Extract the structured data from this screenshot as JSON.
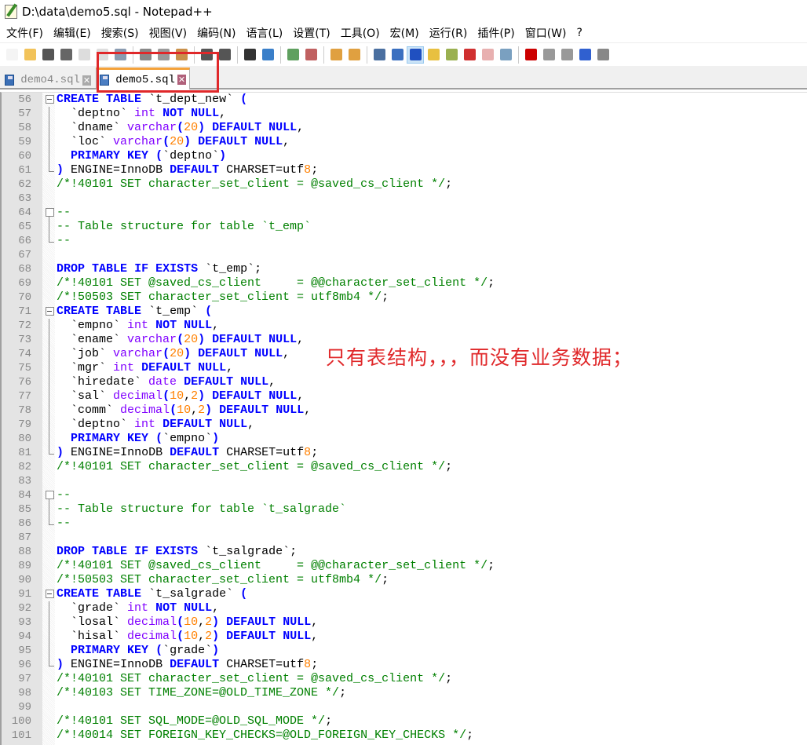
{
  "window": {
    "title": "D:\\data\\demo5.sql - Notepad++"
  },
  "menu": [
    "文件(F)",
    "编辑(E)",
    "搜索(S)",
    "视图(V)",
    "编码(N)",
    "语言(L)",
    "设置(T)",
    "工具(O)",
    "宏(M)",
    "运行(R)",
    "插件(P)",
    "窗口(W)",
    "?"
  ],
  "toolbar": [
    {
      "icon": "new-file-icon",
      "color": "#f4f4f4"
    },
    {
      "icon": "open-file-icon",
      "color": "#f2c35a"
    },
    {
      "icon": "save-icon",
      "color": "#555555"
    },
    {
      "icon": "save-all-icon",
      "color": "#666666"
    },
    {
      "icon": "close-icon",
      "color": "#dddddd"
    },
    {
      "icon": "close-all-icon",
      "color": "#dddddd"
    },
    {
      "icon": "print-icon",
      "color": "#8a9bb0"
    },
    "sep",
    {
      "icon": "cut-icon",
      "color": "#888888"
    },
    {
      "icon": "copy-icon",
      "color": "#999999"
    },
    {
      "icon": "paste-icon",
      "color": "#c9904a"
    },
    "sep",
    {
      "icon": "undo-icon",
      "color": "#555555"
    },
    {
      "icon": "redo-icon",
      "color": "#555555"
    },
    "sep",
    {
      "icon": "find-icon",
      "color": "#333333"
    },
    {
      "icon": "replace-icon",
      "color": "#3a7fc9"
    },
    "sep",
    {
      "icon": "zoom-in-icon",
      "color": "#5fa05f"
    },
    {
      "icon": "zoom-out-icon",
      "color": "#c06060"
    },
    "sep",
    {
      "icon": "sync-vertical-icon",
      "color": "#e0a040"
    },
    {
      "icon": "sync-horizontal-icon",
      "color": "#e0a040"
    },
    "sep",
    {
      "icon": "word-wrap-icon",
      "color": "#4a6fa0"
    },
    {
      "icon": "show-all-chars-icon",
      "color": "#3a6fc0"
    },
    {
      "icon": "indent-guide-icon",
      "color": "#2050c0",
      "active": true
    },
    {
      "icon": "udl-icon",
      "color": "#e8c040"
    },
    {
      "icon": "doc-map-icon",
      "color": "#9ab050"
    },
    {
      "icon": "function-list-icon",
      "color": "#d03030"
    },
    {
      "icon": "folder-workspace-icon",
      "color": "#e8b0b0"
    },
    {
      "icon": "monitoring-icon",
      "color": "#7aa0c0"
    },
    "sep",
    {
      "icon": "record-macro-icon",
      "color": "#cc0000"
    },
    {
      "icon": "stop-record-icon",
      "color": "#999999"
    },
    {
      "icon": "play-macro-icon",
      "color": "#999999"
    },
    {
      "icon": "run-macro-multiple-icon",
      "color": "#3060d0"
    },
    {
      "icon": "save-macro-icon",
      "color": "#888888"
    }
  ],
  "tabs": [
    {
      "label": "demo4.sql",
      "close": "✕"
    },
    {
      "label": "demo5.sql",
      "close": "✕"
    }
  ],
  "lines": [
    {
      "n": "56",
      "fold": "start",
      "text": "CREATE TABLE `t_dept_new` ("
    },
    {
      "n": "57",
      "fold": "mid",
      "text": "  `deptno` int NOT NULL,"
    },
    {
      "n": "58",
      "fold": "mid",
      "text": "  `dname` varchar(20) DEFAULT NULL,"
    },
    {
      "n": "59",
      "fold": "mid",
      "text": "  `loc` varchar(20) DEFAULT NULL,"
    },
    {
      "n": "60",
      "fold": "mid",
      "text": "  PRIMARY KEY (`deptno`)"
    },
    {
      "n": "61",
      "fold": "end",
      "text": ") ENGINE=InnoDB DEFAULT CHARSET=utf8;"
    },
    {
      "n": "62",
      "fold": "",
      "text": "/*!40101 SET character_set_client = @saved_cs_client */;"
    },
    {
      "n": "63",
      "fold": "",
      "text": ""
    },
    {
      "n": "64",
      "fold": "startc",
      "text": "--"
    },
    {
      "n": "65",
      "fold": "mid",
      "text": "-- Table structure for table `t_emp`"
    },
    {
      "n": "66",
      "fold": "end",
      "text": "--"
    },
    {
      "n": "67",
      "fold": "",
      "text": ""
    },
    {
      "n": "68",
      "fold": "",
      "text": "DROP TABLE IF EXISTS `t_emp`;"
    },
    {
      "n": "69",
      "fold": "",
      "text": "/*!40101 SET @saved_cs_client     = @@character_set_client */;"
    },
    {
      "n": "70",
      "fold": "",
      "text": "/*!50503 SET character_set_client = utf8mb4 */;"
    },
    {
      "n": "71",
      "fold": "start",
      "text": "CREATE TABLE `t_emp` ("
    },
    {
      "n": "72",
      "fold": "mid",
      "text": "  `empno` int NOT NULL,"
    },
    {
      "n": "73",
      "fold": "mid",
      "text": "  `ename` varchar(20) DEFAULT NULL,"
    },
    {
      "n": "74",
      "fold": "mid",
      "text": "  `job` varchar(20) DEFAULT NULL,"
    },
    {
      "n": "75",
      "fold": "mid",
      "text": "  `mgr` int DEFAULT NULL,"
    },
    {
      "n": "76",
      "fold": "mid",
      "text": "  `hiredate` date DEFAULT NULL,"
    },
    {
      "n": "77",
      "fold": "mid",
      "text": "  `sal` decimal(10,2) DEFAULT NULL,"
    },
    {
      "n": "78",
      "fold": "mid",
      "text": "  `comm` decimal(10,2) DEFAULT NULL,"
    },
    {
      "n": "79",
      "fold": "mid",
      "text": "  `deptno` int DEFAULT NULL,"
    },
    {
      "n": "80",
      "fold": "mid",
      "text": "  PRIMARY KEY (`empno`)"
    },
    {
      "n": "81",
      "fold": "end",
      "text": ") ENGINE=InnoDB DEFAULT CHARSET=utf8;"
    },
    {
      "n": "82",
      "fold": "",
      "text": "/*!40101 SET character_set_client = @saved_cs_client */;"
    },
    {
      "n": "83",
      "fold": "",
      "text": ""
    },
    {
      "n": "84",
      "fold": "startc",
      "text": "--"
    },
    {
      "n": "85",
      "fold": "mid",
      "text": "-- Table structure for table `t_salgrade`"
    },
    {
      "n": "86",
      "fold": "end",
      "text": "--"
    },
    {
      "n": "87",
      "fold": "",
      "text": ""
    },
    {
      "n": "88",
      "fold": "",
      "text": "DROP TABLE IF EXISTS `t_salgrade`;"
    },
    {
      "n": "89",
      "fold": "",
      "text": "/*!40101 SET @saved_cs_client     = @@character_set_client */;"
    },
    {
      "n": "90",
      "fold": "",
      "text": "/*!50503 SET character_set_client = utf8mb4 */;"
    },
    {
      "n": "91",
      "fold": "start",
      "text": "CREATE TABLE `t_salgrade` ("
    },
    {
      "n": "92",
      "fold": "mid",
      "text": "  `grade` int NOT NULL,"
    },
    {
      "n": "93",
      "fold": "mid",
      "text": "  `losal` decimal(10,2) DEFAULT NULL,"
    },
    {
      "n": "94",
      "fold": "mid",
      "text": "  `hisal` decimal(10,2) DEFAULT NULL,"
    },
    {
      "n": "95",
      "fold": "mid",
      "text": "  PRIMARY KEY (`grade`)"
    },
    {
      "n": "96",
      "fold": "end",
      "text": ") ENGINE=InnoDB DEFAULT CHARSET=utf8;"
    },
    {
      "n": "97",
      "fold": "",
      "text": "/*!40101 SET character_set_client = @saved_cs_client */;"
    },
    {
      "n": "98",
      "fold": "",
      "text": "/*!40103 SET TIME_ZONE=@OLD_TIME_ZONE */;"
    },
    {
      "n": "99",
      "fold": "",
      "text": ""
    },
    {
      "n": "100",
      "fold": "",
      "text": "/*!40101 SET SQL_MODE=@OLD_SQL_MODE */;"
    },
    {
      "n": "101",
      "fold": "",
      "text": "/*!40014 SET FOREIGN_KEY_CHECKS=@OLD_FOREIGN_KEY_CHECKS */;"
    }
  ],
  "annotation": "只有表结构，，，而没有业务数据；",
  "colors": {
    "keyword": "#0000ff",
    "type": "#8000ff",
    "number": "#ff8000",
    "comment": "#008000",
    "annotation": "#e0282a"
  }
}
